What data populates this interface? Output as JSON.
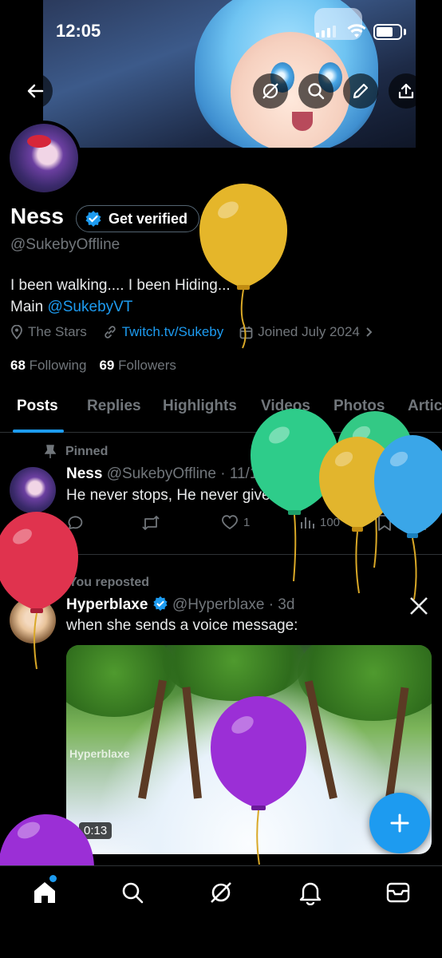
{
  "status_bar": {
    "time": "12:05"
  },
  "profile": {
    "name": "Ness",
    "verify_label": "Get verified",
    "handle": "@SukebyOffline",
    "bio_line1": "I been walking.... I been Hiding...",
    "bio_main_prefix": "Main ",
    "bio_main_link": "@SukebyVT",
    "location": "The Stars",
    "website": "Twitch.tv/Sukeby",
    "joined": "Joined July 2024",
    "following_count": "68",
    "following_label": "Following",
    "followers_count": "69",
    "followers_label": "Followers"
  },
  "tabs": [
    "Posts",
    "Replies",
    "Highlights",
    "Videos",
    "Photos",
    "Artic"
  ],
  "pinned_post": {
    "pinned_label": "Pinned",
    "author_name": "Ness",
    "author_handle": "@SukebyOffline",
    "date": "· 11/10/25",
    "text": "He never stops, He never gives up!",
    "likes": "1",
    "views": "100"
  },
  "repost": {
    "repost_label": "You reposted",
    "author_name": "Hyperblaxe",
    "author_handle": "@Hyperblaxe",
    "date": "· 3d",
    "text": "when she sends a voice message:",
    "watermark": "Hyperblaxe",
    "duration": "0:13"
  },
  "colors": {
    "accent": "#1d9bf0",
    "background": "#000000",
    "muted": "#71767b",
    "divider": "#2f3336"
  },
  "icons": [
    "back-arrow-icon",
    "grok-icon",
    "search-icon",
    "edit-icon",
    "share-icon",
    "location-icon",
    "link-icon",
    "calendar-icon",
    "pin-icon",
    "reply-icon",
    "repost-icon",
    "like-icon",
    "views-icon",
    "bookmark-icon",
    "x-logo-icon",
    "verified-badge-icon",
    "plus-icon",
    "home-icon",
    "bell-icon",
    "mail-icon"
  ]
}
